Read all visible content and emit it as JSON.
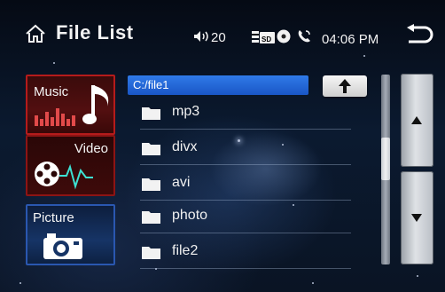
{
  "header": {
    "title": "File List",
    "volume": "20",
    "time": "04:06 PM",
    "icons": [
      "home-icon",
      "speaker-icon",
      "sd-card-icon",
      "disc-icon",
      "phone-icon",
      "back-icon"
    ]
  },
  "sources": [
    {
      "label": "Music",
      "icon": "music-note-icon",
      "color": "#b51b1b"
    },
    {
      "label": "Video",
      "icon": "film-reel-icon",
      "color": "#8d1414"
    },
    {
      "label": "Picture",
      "icon": "camera-icon",
      "color": "#2a57b0"
    }
  ],
  "browser": {
    "path": "C:/file1",
    "folders": [
      "mp3",
      "divx",
      "avi",
      "photo",
      "file2"
    ]
  },
  "colors": {
    "path_highlight": "#2f7ae8",
    "text": "#f0f0f0"
  }
}
